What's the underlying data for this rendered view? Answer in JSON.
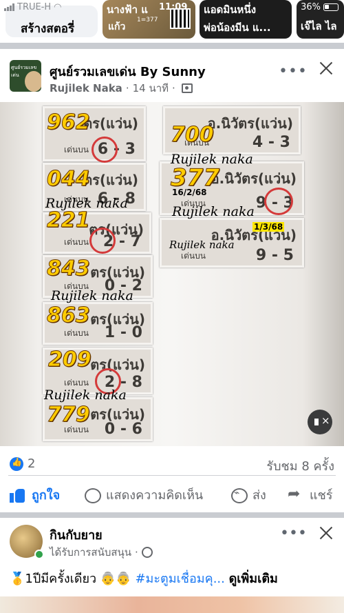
{
  "status_bar": {
    "carrier": "TRUE-H",
    "time": "11:09",
    "battery": "36%"
  },
  "stories": {
    "create_label": "สร้างสตอรี่",
    "cards": [
      {
        "line1": "นางฟ้า แ",
        "line2": "แก้ว",
        "extra": "1=377"
      },
      {
        "line1": "แอดมินหนึ่ง",
        "line2": "พ่อน้องมีน แ..."
      },
      {
        "line1": "เจ๊ไล ไล"
      }
    ]
  },
  "post": {
    "page_name": "ศูนย์รวมเลขเด่น By Sunny",
    "author": "Rujilek Naka",
    "time_ago": "14 นาที",
    "avatar_text": "ศูนย์รวมเลขเด่น",
    "more_label": "•••",
    "image": {
      "tickets": [
        {
          "numbers": "962",
          "header": "ตร(แว่น)",
          "sub": "เด่นบน",
          "digits": "6 - 3"
        },
        {
          "numbers": "044",
          "header": "ตร(แว่น)",
          "sub": "เด่นบน",
          "digits": "6 - 8"
        },
        {
          "numbers": "221",
          "header": "ตร(แว่น)",
          "sub": "เด่นบน",
          "digits": "2 - 7"
        },
        {
          "numbers": "843",
          "header": "ตร(แว่น)",
          "sub": "เด่นบน",
          "digits": "0 - 2"
        },
        {
          "numbers": "863",
          "header": "ตร(แว่น)",
          "sub": "เด่นบน",
          "digits": "1 - 0"
        },
        {
          "numbers": "209",
          "header": "ตร(แว่น)",
          "sub": "เด่นบน",
          "digits": "2 - 8"
        },
        {
          "numbers": "779",
          "header": "ตร(แว่น)",
          "sub": "เด่นบน",
          "digits": "0 - 6"
        },
        {
          "numbers": "700",
          "header": "อ.นิวัตร(แว่น)",
          "sub": "เด่นบน",
          "digits": "4 - 3"
        },
        {
          "numbers": "377",
          "header": "อ.นิวัตร(แว่น)",
          "sub": "เด่นบน",
          "digits": "9 - 3",
          "date": "16/2/68"
        },
        {
          "numbers": "",
          "header": "อ.นิวัตร(แว่น)",
          "sub": "เด่นบน",
          "digits": "9 - 5",
          "date": "1/3/68"
        }
      ],
      "watermark": "Rujilek naka"
    },
    "reaction_count": "2",
    "views": "รับชม 8 ครั้ง",
    "actions": {
      "like": "ถูกใจ",
      "comment": "แสดงความคิดเห็น",
      "send": "ส่ง",
      "share": "แชร์"
    }
  },
  "post2": {
    "name": "กินกับยาย",
    "sponsored": "ได้รับการสนับสนุน",
    "text": "🥇1ปีมีครั้งเดียว 👵👵",
    "hashtag": "#มะตูมเชื่อมคุ...",
    "see_more": "ดูเพิ่มเติม",
    "more_label": "•••"
  }
}
